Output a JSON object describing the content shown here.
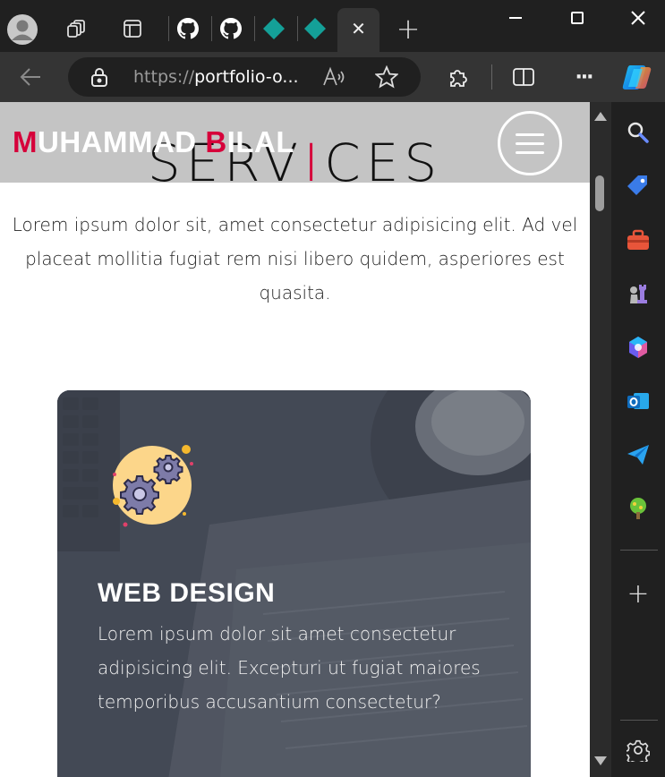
{
  "browser": {
    "new_tab_glyph": "+",
    "close_tab_glyph": "✕",
    "url_prefix": "https://",
    "url_host": "portfolio-o...",
    "more_glyph": "···",
    "window_controls": {
      "minimize": "—",
      "maximize": "☐",
      "close": "✕"
    }
  },
  "site": {
    "brand_initial_1": "M",
    "brand_rest_1": "UHAMMAD ",
    "brand_initial_2": "B",
    "brand_rest_2": "ILAL",
    "section_title_a": "SERV",
    "section_title_accent": "I",
    "section_title_b": "CES",
    "intro": "Lorem ipsum dolor sit, amet consectetur adipisicing elit. Ad vel placeat mollitia fugiat rem nisi libero quidem, asperiores est quasita.",
    "card": {
      "title": "WEB DESIGN",
      "text": "Lorem ipsum dolor sit amet consectetur adipisicing elit. Excepturi ut fugiat maiores temporibus accusantium consectetur?"
    }
  },
  "sidebar": {
    "add_glyph": "+"
  },
  "colors": {
    "accent": "#d6003a",
    "header_bg": "#c4c4c4",
    "card_bg": "#4e5461",
    "chrome_dark": "#202020",
    "chrome_mid": "#343434"
  }
}
